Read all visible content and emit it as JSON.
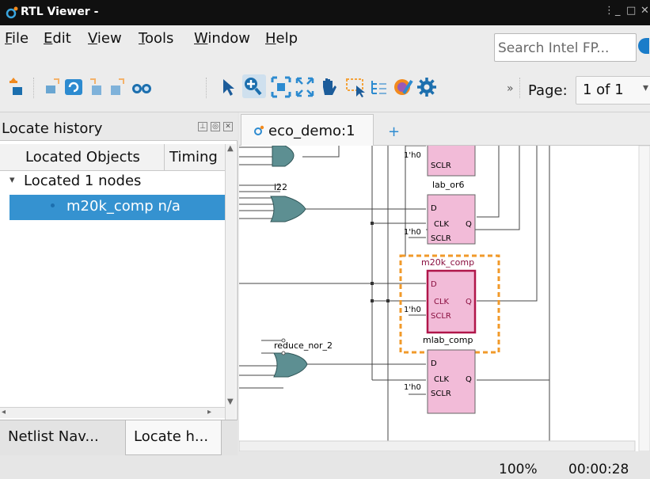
{
  "window": {
    "title": "RTL Viewer -"
  },
  "menu": [
    {
      "label": "File",
      "mnemonic": "F",
      "rest": "ile"
    },
    {
      "label": "Edit",
      "mnemonic": "E",
      "rest": "dit"
    },
    {
      "label": "View",
      "mnemonic": "V",
      "rest": "iew"
    },
    {
      "label": "Tools",
      "mnemonic": "T",
      "rest": "ools"
    },
    {
      "label": "Window",
      "mnemonic": "W",
      "rest": "indow"
    },
    {
      "label": "Help",
      "mnemonic": "H",
      "rest": "elp"
    }
  ],
  "search": {
    "placeholder": "Search Intel FP..."
  },
  "toolbar": {
    "icons": [
      "move-up-icon",
      "move-down-icon",
      "refresh-icon",
      "back-icon",
      "forward-icon",
      "find-icon",
      "select-icon",
      "zoom-icon",
      "fit-window-icon",
      "full-screen-icon",
      "hand-icon",
      "rubber-band-icon",
      "hierarchy-icon",
      "color-settings-icon",
      "settings-icon"
    ],
    "overflow": "»",
    "page_label": "Page:",
    "page_value": "1 of 1"
  },
  "left_panel": {
    "title": "Locate history",
    "columns": [
      "Located Objects",
      "Timing"
    ],
    "group": "Located 1 nodes",
    "item": "m20k_comp n/a"
  },
  "bottom_tabs": [
    "Netlist Nav...",
    "Locate h..."
  ],
  "doc_tabs": {
    "active": "eco_demo:1",
    "add": "+"
  },
  "canvas": {
    "ff_labels": [
      "lab_or6",
      "m20k_comp",
      "mlab_comp"
    ],
    "pin_D": "D",
    "pin_CLK": "CLK",
    "pin_Q": "Q",
    "pin_SCLR": "SCLR",
    "const": "1'h0",
    "gate_labels": [
      "i22",
      "reduce_nor_2"
    ]
  },
  "colors": {
    "accent": "#3592d0",
    "ff_fill": "#f2bbd8",
    "highlight": "#b0164a",
    "selection_box": "#f19a2a",
    "gate_fill": "#5d8f92"
  },
  "status": {
    "zoom": "100%",
    "time": "00:00:28"
  }
}
